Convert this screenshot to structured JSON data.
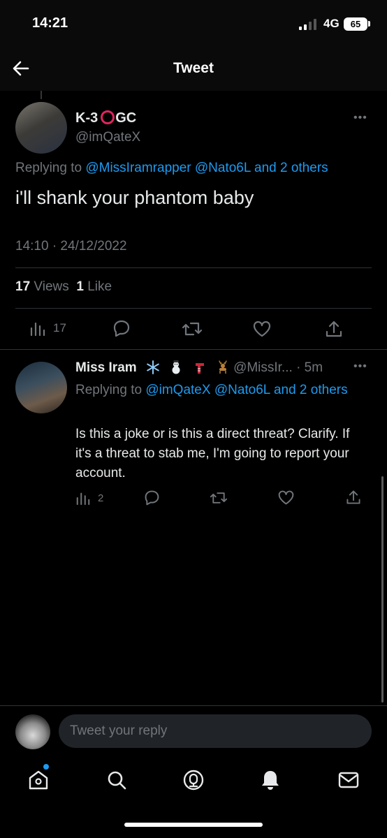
{
  "status": {
    "time": "14:21",
    "network": "4G",
    "battery": "65"
  },
  "header": {
    "title": "Tweet"
  },
  "main_tweet": {
    "name": "K-3",
    "name_suffix": "GC",
    "handle": "@imQateX",
    "replying_prefix": "Replying to",
    "replying_to": "@MissIramrapper @Nato6L and 2 others",
    "text": "i'll shank your phantom baby",
    "datetime": "14:10 · 24/12/2022",
    "views_count": "17",
    "views_label": "Views",
    "likes_count": "1",
    "likes_label": "Like",
    "analytics_count": "17"
  },
  "reply_tweet": {
    "name": "Miss Iram",
    "handle": "@MissIr...",
    "time": "· 5m",
    "replying_prefix": "Replying to",
    "replying_to": "@imQateX @Nato6L and 2 others",
    "text": "Is this a joke or is this a direct threat? Clarify. If it's a threat to stab me, I'm going to report your account.",
    "analytics_count": "2"
  },
  "compose": {
    "placeholder": "Tweet your reply"
  },
  "colors": {
    "accent": "#1d9bf0",
    "muted": "#71767b",
    "ring": "#e0245e"
  },
  "icons": [
    "back-arrow-icon",
    "more-icon",
    "analytics-icon",
    "reply-icon",
    "retweet-icon",
    "like-icon",
    "share-icon",
    "home-icon",
    "search-icon",
    "spaces-icon",
    "notifications-icon",
    "messages-icon"
  ]
}
